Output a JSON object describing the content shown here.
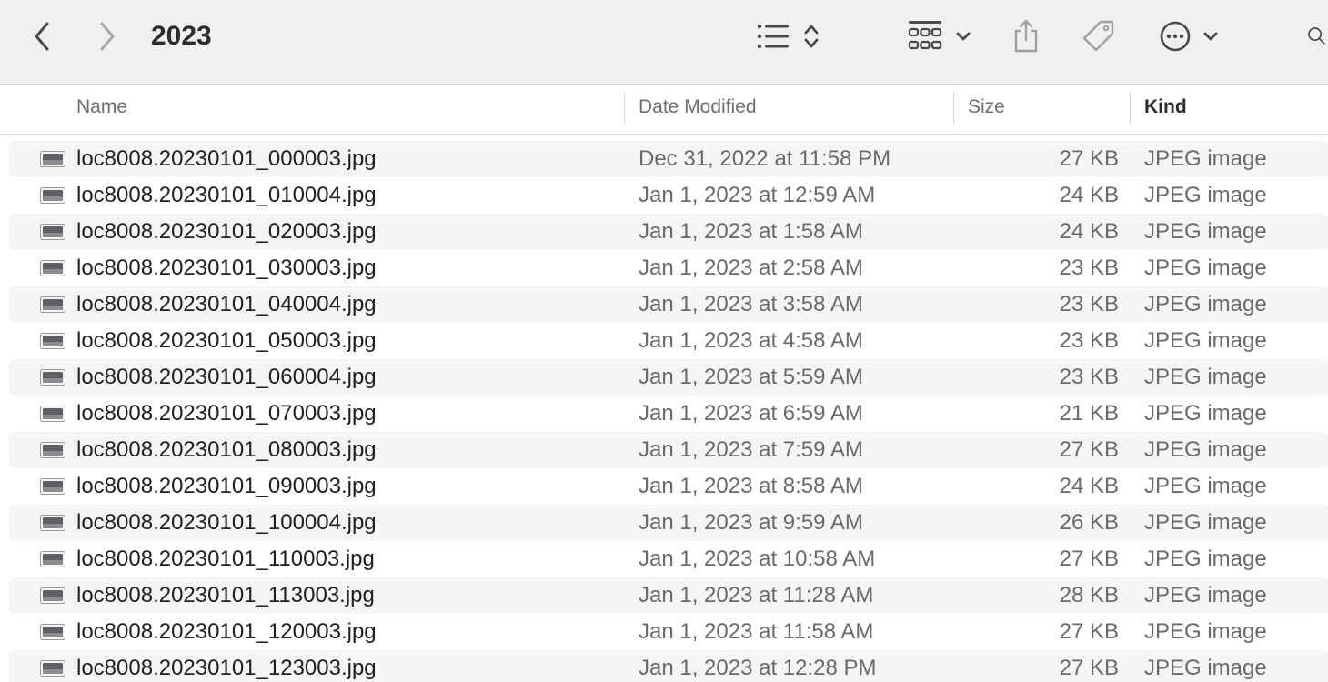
{
  "window": {
    "title": "2023"
  },
  "toolbar": {
    "icons": [
      "back-icon",
      "forward-icon",
      "list-view-icon",
      "sort-arrows-icon",
      "group-icon",
      "chevron-down-icon",
      "share-icon",
      "tag-icon",
      "more-icon",
      "search-icon"
    ]
  },
  "columns": [
    {
      "label": "Name"
    },
    {
      "label": "Date Modified"
    },
    {
      "label": "Size"
    },
    {
      "label": "Kind"
    }
  ],
  "files": [
    {
      "name": "loc8008.20230101_000003.jpg",
      "date": "Dec 31, 2022 at 11:58 PM",
      "size": "27 KB",
      "kind": "JPEG image"
    },
    {
      "name": "loc8008.20230101_010004.jpg",
      "date": "Jan 1, 2023 at 12:59 AM",
      "size": "24 KB",
      "kind": "JPEG image"
    },
    {
      "name": "loc8008.20230101_020003.jpg",
      "date": "Jan 1, 2023 at 1:58 AM",
      "size": "24 KB",
      "kind": "JPEG image"
    },
    {
      "name": "loc8008.20230101_030003.jpg",
      "date": "Jan 1, 2023 at 2:58 AM",
      "size": "23 KB",
      "kind": "JPEG image"
    },
    {
      "name": "loc8008.20230101_040004.jpg",
      "date": "Jan 1, 2023 at 3:58 AM",
      "size": "23 KB",
      "kind": "JPEG image"
    },
    {
      "name": "loc8008.20230101_050003.jpg",
      "date": "Jan 1, 2023 at 4:58 AM",
      "size": "23 KB",
      "kind": "JPEG image"
    },
    {
      "name": "loc8008.20230101_060004.jpg",
      "date": "Jan 1, 2023 at 5:59 AM",
      "size": "23 KB",
      "kind": "JPEG image"
    },
    {
      "name": "loc8008.20230101_070003.jpg",
      "date": "Jan 1, 2023 at 6:59 AM",
      "size": "21 KB",
      "kind": "JPEG image"
    },
    {
      "name": "loc8008.20230101_080003.jpg",
      "date": "Jan 1, 2023 at 7:59 AM",
      "size": "27 KB",
      "kind": "JPEG image"
    },
    {
      "name": "loc8008.20230101_090003.jpg",
      "date": "Jan 1, 2023 at 8:58 AM",
      "size": "24 KB",
      "kind": "JPEG image"
    },
    {
      "name": "loc8008.20230101_100004.jpg",
      "date": "Jan 1, 2023 at 9:59 AM",
      "size": "26 KB",
      "kind": "JPEG image"
    },
    {
      "name": "loc8008.20230101_110003.jpg",
      "date": "Jan 1, 2023 at 10:58 AM",
      "size": "27 KB",
      "kind": "JPEG image"
    },
    {
      "name": "loc8008.20230101_113003.jpg",
      "date": "Jan 1, 2023 at 11:28 AM",
      "size": "28 KB",
      "kind": "JPEG image"
    },
    {
      "name": "loc8008.20230101_120003.jpg",
      "date": "Jan 1, 2023 at 11:58 AM",
      "size": "27 KB",
      "kind": "JPEG image"
    },
    {
      "name": "loc8008.20230101_123003.jpg",
      "date": "Jan 1, 2023 at 12:28 PM",
      "size": "27 KB",
      "kind": "JPEG image"
    }
  ],
  "colors": {
    "toolbar_bg": "#f0f0f0",
    "row_alt": "#f4f5f5",
    "icon_gray": "#8a8a8a"
  }
}
